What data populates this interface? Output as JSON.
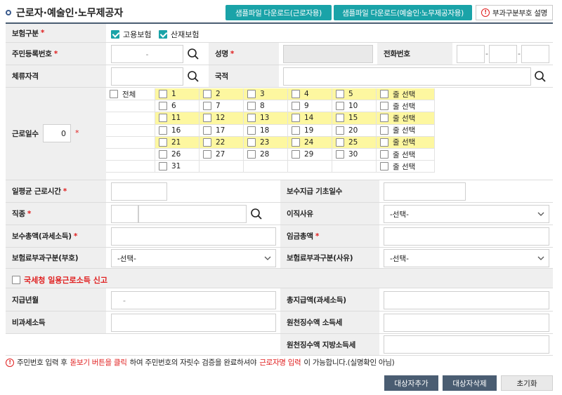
{
  "title": "근로자·예술인·노무제공자",
  "header_buttons": {
    "sample_worker": "샘플파일 다운로드(근로자용)",
    "sample_artist": "샘플파일 다운로드(예술인·노무제공자용)",
    "info": "부과구분부호 설명"
  },
  "form": {
    "insurance_type_label": "보험구분",
    "employment_insurance": "고용보험",
    "accident_insurance": "산재보험",
    "rrn_label": "주민등록번호",
    "rrn_separator": "-",
    "name_label": "성명",
    "phone_label": "전화번호",
    "phone_sep1": "-",
    "phone_sep2": "-",
    "stay_status_label": "체류자격",
    "nationality_label": "국적",
    "work_days_label": "근로일수",
    "work_days_value": "0",
    "all_label": "전체",
    "row_select": "줄 선택",
    "avg_hours_label": "일평균 근로시간",
    "pay_base_days_label": "보수지급 기초일수",
    "job_label": "직종",
    "leave_reason_label": "이직사유",
    "leave_reason_value": "-선택-",
    "total_pay_label": "보수총액(과세소득)",
    "total_wage_label": "임금총액",
    "premium_code_label": "보험료부과구분(부호)",
    "premium_code_value": "-선택-",
    "premium_reason_label": "보험료부과구분(사유)",
    "premium_reason_value": "-선택-",
    "nts_report_label": "국세청 일용근로소득 신고",
    "pay_month_label": "지급년월",
    "pay_month_value": "-",
    "total_payment_label": "총지급액(과세소득)",
    "nontax_label": "비과세소득",
    "income_tax_label": "원천징수액 소득세",
    "local_tax_label": "원천징수액 지방소득세"
  },
  "day_rows": [
    [
      "1",
      "2",
      "3",
      "4",
      "5"
    ],
    [
      "6",
      "7",
      "8",
      "9",
      "10"
    ],
    [
      "11",
      "12",
      "13",
      "14",
      "15"
    ],
    [
      "16",
      "17",
      "18",
      "19",
      "20"
    ],
    [
      "21",
      "22",
      "23",
      "24",
      "25"
    ],
    [
      "26",
      "27",
      "28",
      "29",
      "30"
    ],
    [
      "31",
      "",
      "",
      "",
      ""
    ]
  ],
  "notice": {
    "p1": "주민번호 입력 후 ",
    "p2": "돋보기 버튼을 클릭",
    "p3": "하여 주민번호의 자릿수 검증을 완료하셔야 ",
    "p4": "근로자명 입력",
    "p5": "이 가능합니다.(실명확인 아님)"
  },
  "bottom_buttons": {
    "add": "대상자추가",
    "delete": "대상자삭제",
    "reset": "초기화"
  },
  "colors": {
    "teal": "#1aa3a8",
    "highlight": "#fdf7a0",
    "dark_button": "#4a5d72",
    "reset_button": "#e9e9e9",
    "required": "#e02020"
  }
}
